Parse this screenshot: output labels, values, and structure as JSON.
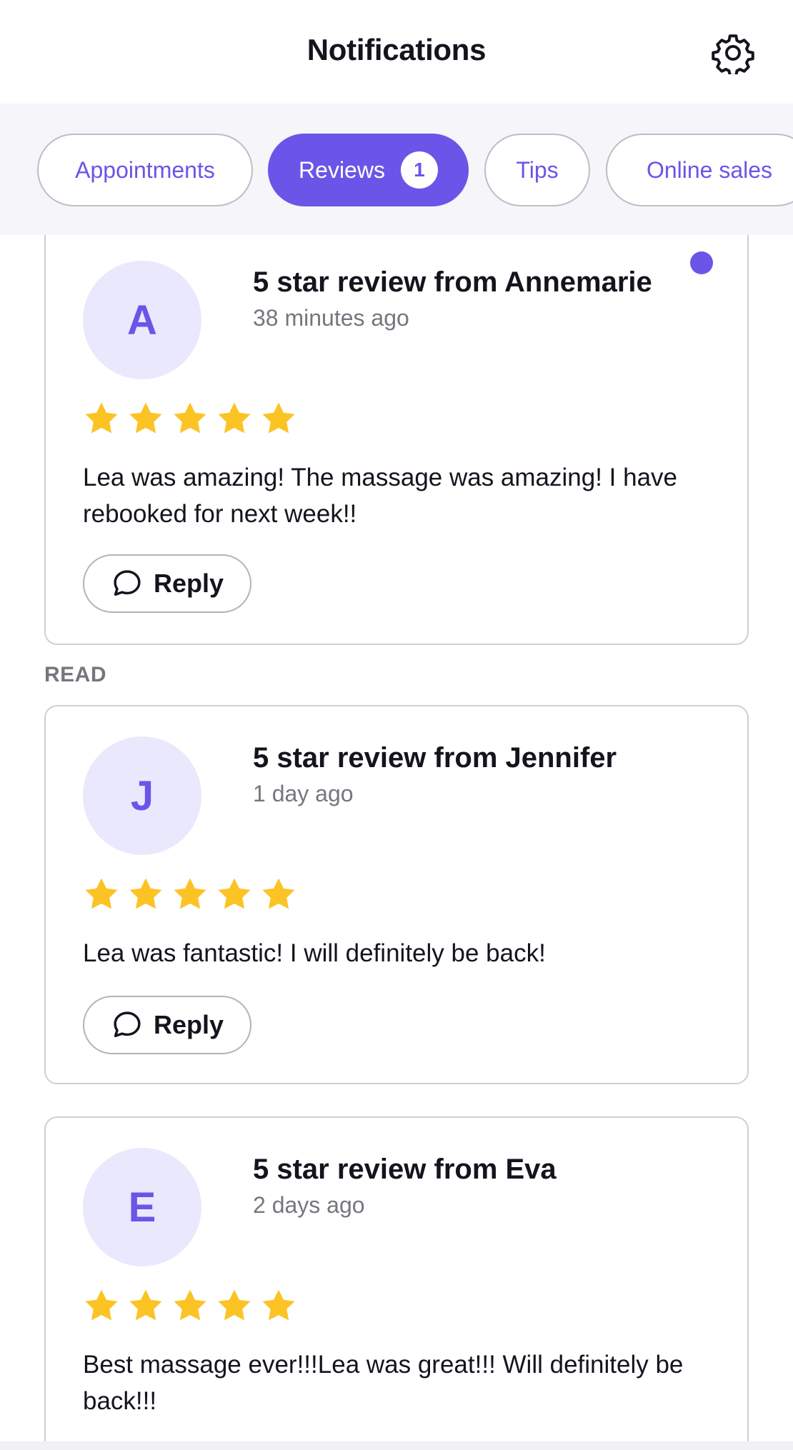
{
  "header": {
    "title": "Notifications",
    "settings_icon": "gear-icon"
  },
  "tabs": [
    {
      "label": "Appointments",
      "active": false
    },
    {
      "label": "Reviews",
      "active": true,
      "badge": "1"
    },
    {
      "label": "Tips",
      "active": false
    },
    {
      "label": "Online sales",
      "active": false
    }
  ],
  "colors": {
    "accent": "#6A55E8",
    "avatar_bg": "#E9E8FC",
    "star": "#FCC325",
    "tabs_bg": "#F5F5FA"
  },
  "unread": [
    {
      "initial": "A",
      "title": "5 star review from Annemarie",
      "time": "38 minutes ago",
      "rating": 5,
      "text": "Lea was amazing! The massage was amazing! I have rebooked for next week!!",
      "reply_label": "Reply",
      "unread_dot": true
    }
  ],
  "read_section_label": "READ",
  "read": [
    {
      "initial": "J",
      "title": "5 star review from Jennifer",
      "time": "1 day ago",
      "rating": 5,
      "text": "Lea was fantastic! I will definitely be back!",
      "reply_label": "Reply"
    },
    {
      "initial": "E",
      "title": "5 star review from Eva",
      "time": "2 days ago",
      "rating": 5,
      "text": "Best massage ever!!!Lea was great!!! Will definitely be back!!!"
    }
  ]
}
